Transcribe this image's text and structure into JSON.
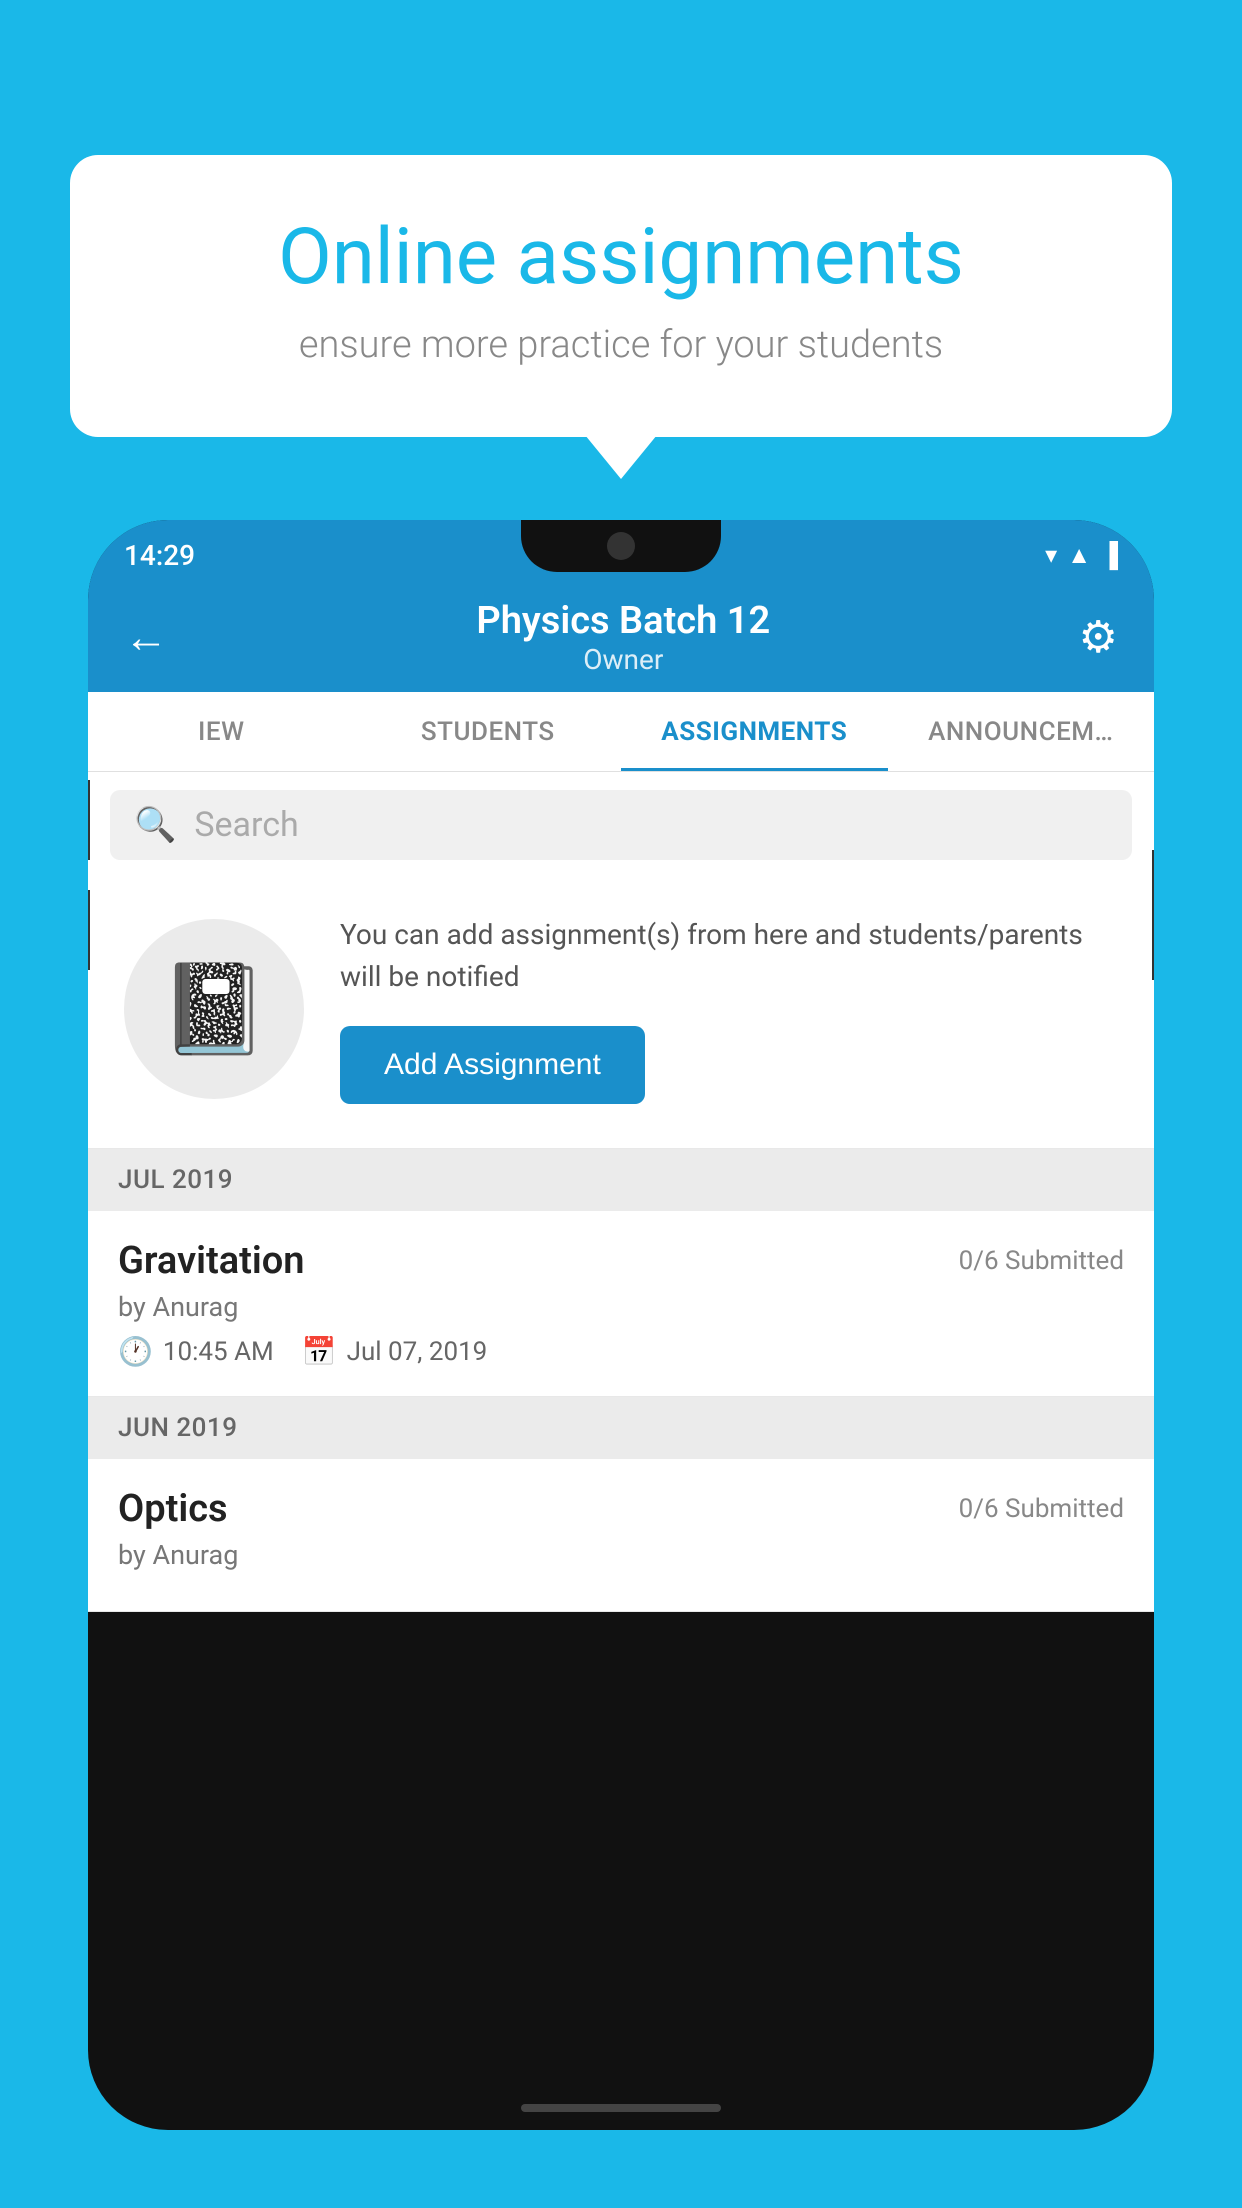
{
  "background": {
    "color": "#1ab8e8"
  },
  "speech_bubble": {
    "title": "Online assignments",
    "subtitle": "ensure more practice for your students"
  },
  "status_bar": {
    "time": "14:29",
    "wifi_icon": "▾",
    "signal_icon": "▲",
    "battery_icon": "▐"
  },
  "header": {
    "back_icon": "←",
    "title": "Physics Batch 12",
    "subtitle": "Owner",
    "settings_icon": "⚙"
  },
  "tabs": [
    {
      "label": "IEW",
      "active": false
    },
    {
      "label": "STUDENTS",
      "active": false
    },
    {
      "label": "ASSIGNMENTS",
      "active": true
    },
    {
      "label": "ANNOUNCEM…",
      "active": false
    }
  ],
  "search": {
    "placeholder": "Search",
    "icon": "🔍"
  },
  "promo": {
    "icon": "📒",
    "description": "You can add assignment(s) from here and students/parents will be notified",
    "button_label": "Add Assignment"
  },
  "assignment_groups": [
    {
      "month_label": "JUL 2019",
      "assignments": [
        {
          "title": "Gravitation",
          "submitted": "0/6 Submitted",
          "author": "by Anurag",
          "time": "10:45 AM",
          "date": "Jul 07, 2019"
        }
      ]
    },
    {
      "month_label": "JUN 2019",
      "assignments": [
        {
          "title": "Optics",
          "submitted": "0/6 Submitted",
          "author": "by Anurag",
          "time": "",
          "date": ""
        }
      ]
    }
  ]
}
